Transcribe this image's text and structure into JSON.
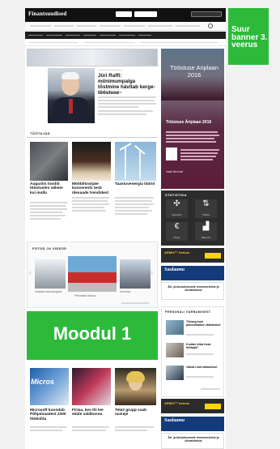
{
  "header": {
    "logo": "Finantsuudised"
  },
  "hero": {
    "title": "Jüri Raffi: miinimumpalga tõstmine hävitab kerge-tööstuse",
    "caption": "Jüri Raffi, Foto: Aivar"
  },
  "tootajad": {
    "label": "TÖÖTAJAD",
    "articles": [
      {
        "title": "Augustis tooditi tööstustes vähem kui mullu"
      },
      {
        "title": "Mööblitootjate konverents tesb ülevaade trendidest"
      },
      {
        "title": "Taastuvenergia liidrid"
      }
    ]
  },
  "tooetuse_promo": {
    "title": "Tööstuse Ariplaan 2016",
    "subtitle": "Tööstuse Äriplaan 2016",
    "more": "Vaata lähemalt"
  },
  "statistika": {
    "label": "STATISTIKA",
    "items": [
      {
        "icon": "network-icon",
        "label": "Ettevõtted"
      },
      {
        "icon": "arrows-icon",
        "label": "Tööjõud"
      },
      {
        "icon": "euro-icon",
        "label": "Palgad"
      },
      {
        "icon": "bar-chart-icon",
        "label": "Majandus"
      }
    ]
  },
  "fotod": {
    "label": "FOTOD JA VIDEOD",
    "items": [
      {
        "title": "Vaadake tehnoloogiaid"
      },
      {
        "title": "Pärnamäe keskus"
      },
      {
        "title": "Uuendus"
      }
    ]
  },
  "ads": {
    "armix": "ARMIX™ betoon",
    "saulaama": "Saulaama",
    "ari": "Äri- ja büroohoonete renoveerimine ja ülevalmistus"
  },
  "moodul": {
    "label": "Moodul 1"
  },
  "banner": {
    "label": "Suur banner 3. veerus"
  },
  "personali": {
    "label": "PERSONALI VÄRBAMISEST",
    "items": [
      {
        "title": "Tööaeg kuni pikendatakse värbamisel"
      },
      {
        "title": "Kuidas leida head töötajat?"
      },
      {
        "title": "Valida Laid värbamisel"
      }
    ]
  },
  "bottom_articles": [
    {
      "title": "Microsoft koondab Põhjamaadest 2300 töökohta"
    },
    {
      "title": "Firma, kes lõi lee edale valdkonna"
    },
    {
      "title": "Tele2 grupp saab naiseje"
    }
  ]
}
